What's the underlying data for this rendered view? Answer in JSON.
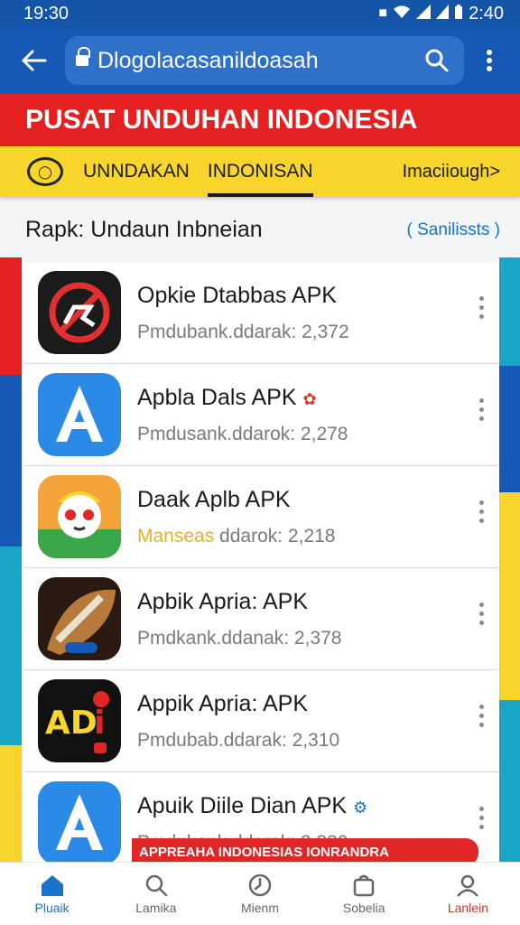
{
  "status_bar": {
    "time": "19:30",
    "battery": "2:40"
  },
  "app_bar": {
    "url": "Dlogolacasanildoasah"
  },
  "banner": {
    "title": "PUSAT UNDUHAN INDONESIA"
  },
  "nav": {
    "tabs": [
      "UNNDAKAN",
      "INDONISAN"
    ],
    "more": "Imaciiough>"
  },
  "section": {
    "title": "Rapk: Undaun Inbneian",
    "link": "( Sanilissts )"
  },
  "apps": [
    {
      "name": "Opkie Dtabbas APK",
      "downloads": "Pmdubank.ddarak: 2,372",
      "downloads_highlight": "",
      "icon": "no-entry-icon"
    },
    {
      "name": "Apbla Dals APK",
      "downloads": "Pmdusank.ddarok: 2,278",
      "downloads_highlight": "",
      "icon": "a-letter-icon"
    },
    {
      "name": "Daak Aplb APK",
      "downloads": " ddarok: 2,218",
      "downloads_highlight": "Manseas",
      "icon": "cartoon-face-icon"
    },
    {
      "name": "Apbik Apria: APK",
      "downloads": "Pmdkank.ddanak: 2,378",
      "downloads_highlight": "",
      "icon": "brush-icon"
    },
    {
      "name": "Appik Apria: APK",
      "downloads": "Pmdubab.ddarak: 2,310",
      "downloads_highlight": "",
      "icon": "adi-icon"
    },
    {
      "name": "Apuik Diile Dian APK",
      "downloads": "Pmdukank.ddarak: 2,320",
      "downloads_highlight": "",
      "icon": "a-letter-icon"
    }
  ],
  "promo": {
    "text": "APPREAHA INDONESIAS IONRANDRA"
  },
  "bottom_nav": [
    {
      "label": "Pluaik",
      "icon": "home-icon"
    },
    {
      "label": "Lamika",
      "icon": "search-icon"
    },
    {
      "label": "Mienm",
      "icon": "clock-icon"
    },
    {
      "label": "Sobelia",
      "icon": "bag-icon"
    },
    {
      "label": "Lanlein",
      "icon": "profile-icon"
    }
  ],
  "colors": {
    "primary": "#1659b4",
    "accent_red": "#e42020",
    "accent_yellow": "#f8d52a",
    "link": "#1a73c8"
  }
}
